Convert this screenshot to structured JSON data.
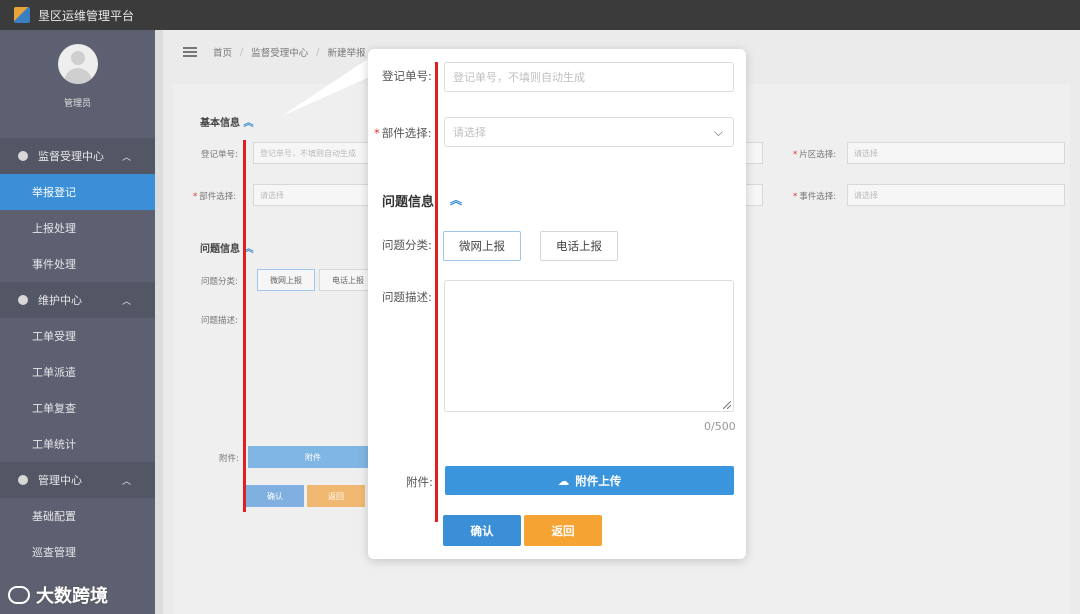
{
  "app": {
    "title": "垦区运维管理平台"
  },
  "sidebar": {
    "user": "管理员",
    "groups": [
      {
        "label": "监督受理中心",
        "items": [
          "举报登记",
          "上报处理",
          "事件处理"
        ]
      },
      {
        "label": "维护中心",
        "items": [
          "工单受理",
          "工单派遣",
          "工单复查",
          "工单统计"
        ]
      },
      {
        "label": "管理中心",
        "items": [
          "基础配置",
          "巡查管理"
        ]
      }
    ],
    "active_item": "举报登记"
  },
  "breadcrumb": {
    "items": [
      "首页",
      "监督受理中心",
      "新建举报"
    ]
  },
  "background_form": {
    "section_basic": "基本信息",
    "reg_label": "登记单号:",
    "reg_placeholder": "登记单号，不填则自动生成",
    "part_label": "部件选择:",
    "part_placeholder": "请选择",
    "area_label": "片区选择:",
    "area_placeholder": "请选择",
    "event_label": "事件选择:",
    "event_placeholder": "请选择",
    "section_problem": "问题信息",
    "category_label": "问题分类:",
    "cat_btn_1": "微网上报",
    "cat_btn_2": "电话上报",
    "desc_label": "问题描述:",
    "attach_label": "附件:",
    "upload_label": "附件",
    "confirm_label": "确认",
    "back_label": "返回"
  },
  "popup": {
    "reg_label": "登记单号:",
    "reg_placeholder": "登记单号，不填则自动生成",
    "part_label": "部件选择:",
    "part_placeholder": "请选择",
    "section_problem": "问题信息",
    "category_label": "问题分类:",
    "cat_btn_1": "微网上报",
    "cat_btn_2": "电话上报",
    "desc_label": "问题描述:",
    "char_count": "0/500",
    "attach_label": "附件:",
    "upload_label": "附件上传",
    "confirm_label": "确认",
    "back_label": "返回"
  },
  "watermark": "大数跨境",
  "colors": {
    "primary": "#3a95dc",
    "confirm": "#3a8fd6",
    "back": "#f5a332",
    "annotation": "#e02020",
    "sidebar": "#5d6070"
  }
}
